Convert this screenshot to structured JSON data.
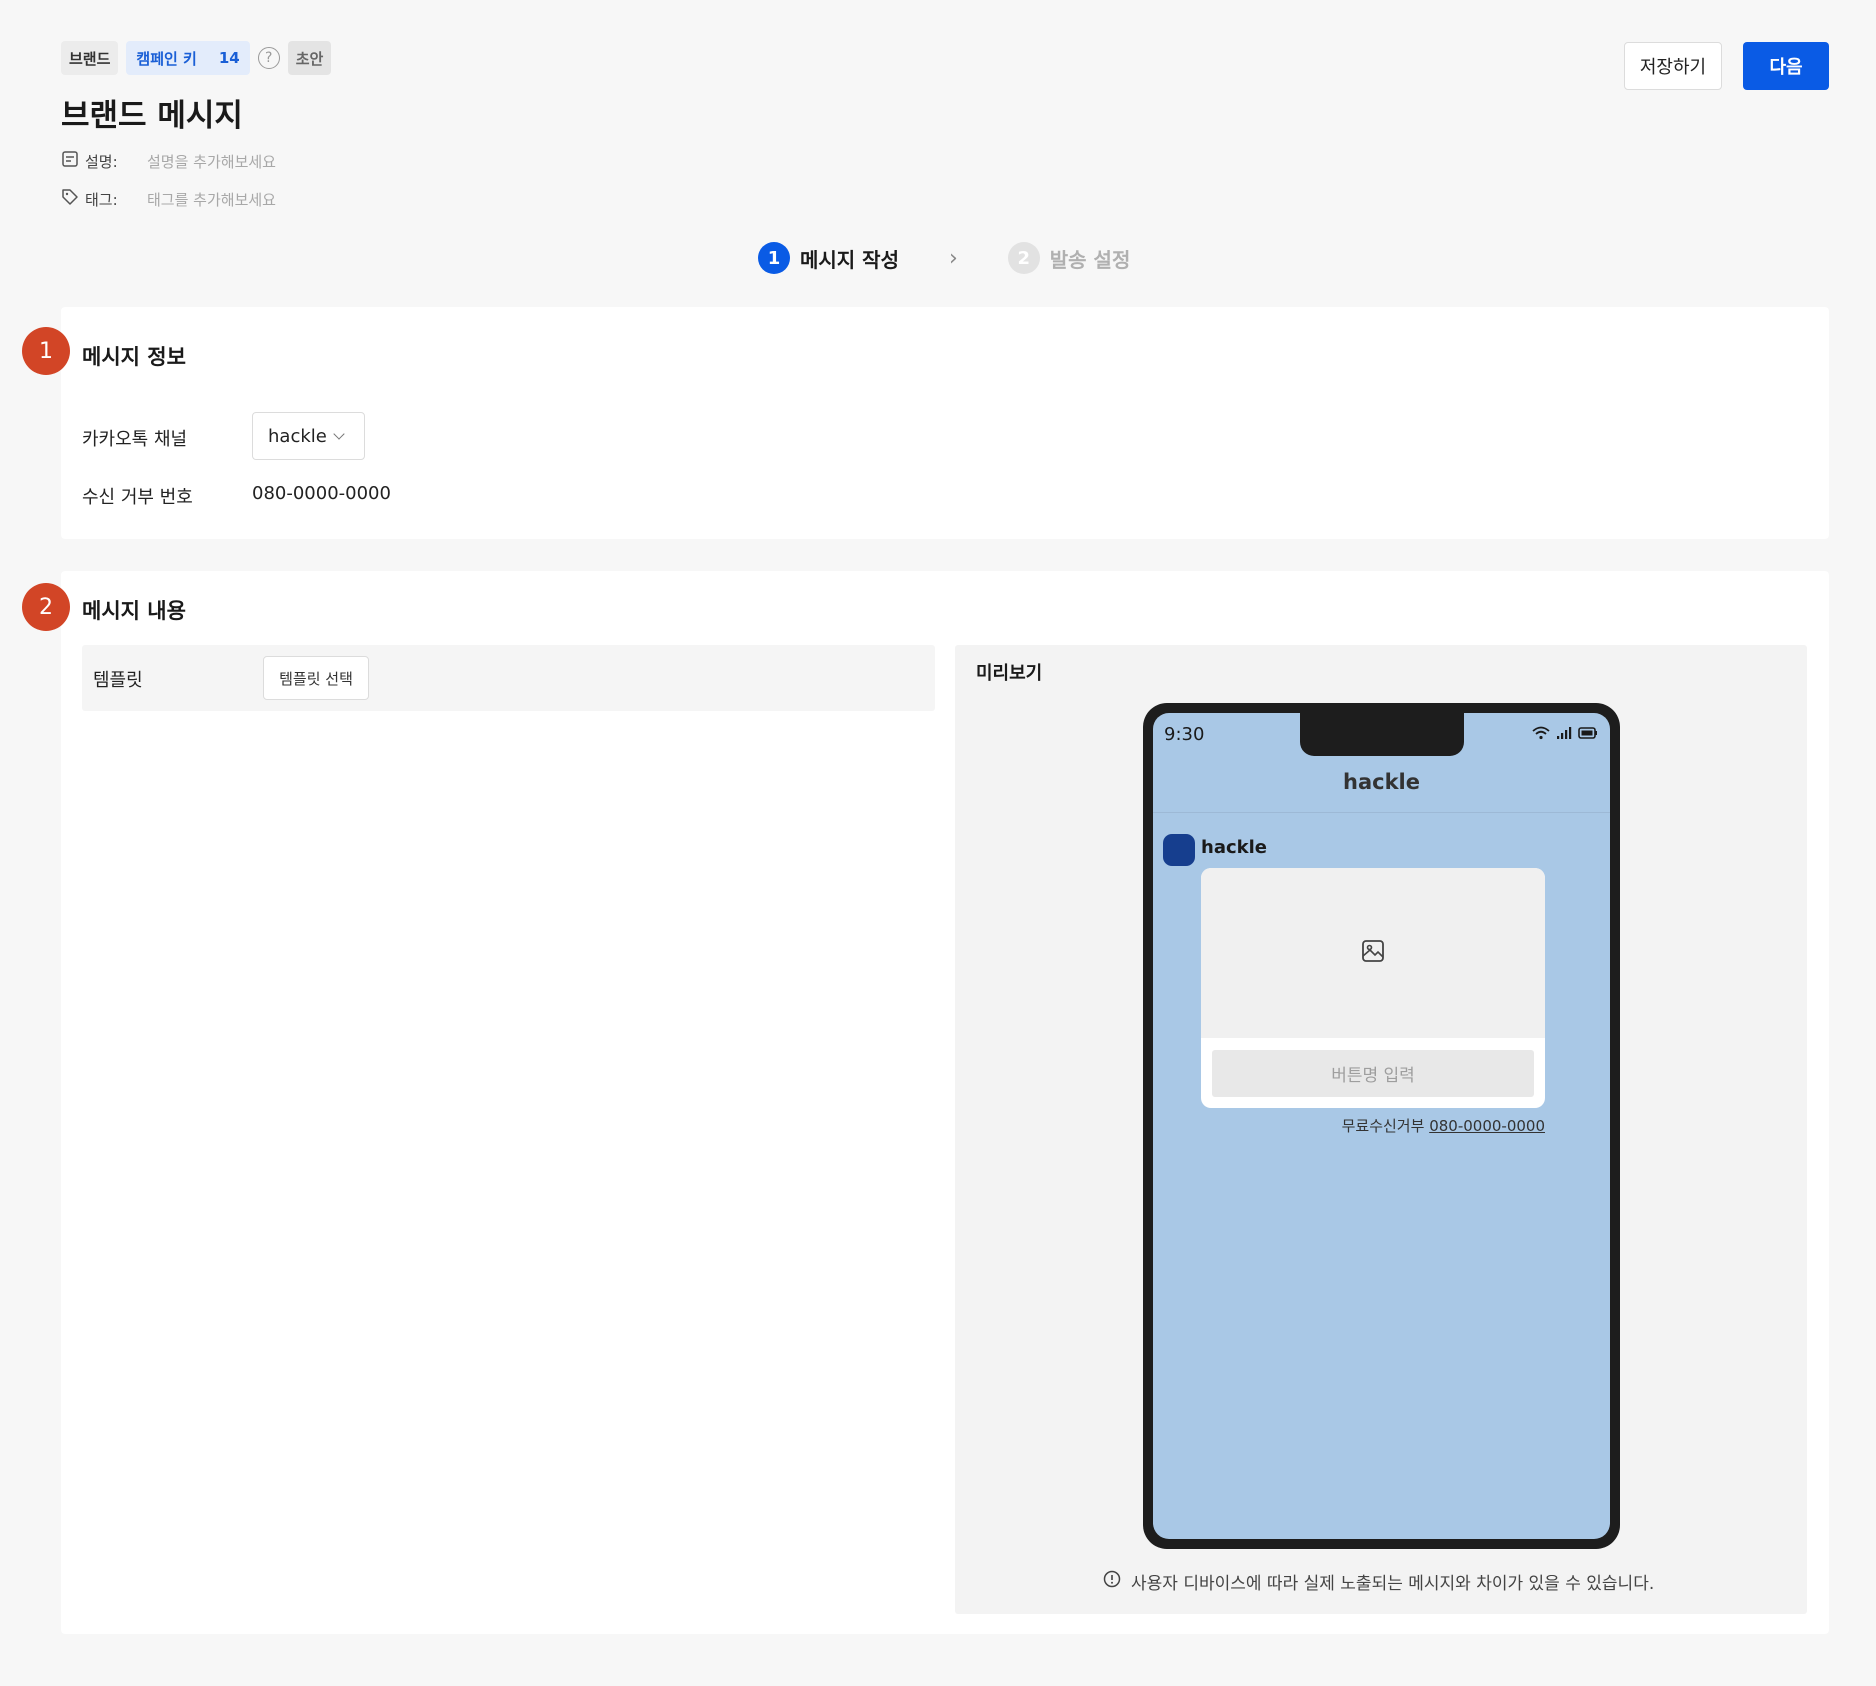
{
  "header": {
    "brand_chip": "브랜드",
    "campaign_key_label": "캠페인 키",
    "campaign_key_value": "14",
    "help_glyph": "?",
    "status_chip": "초안",
    "title": "브랜드 메시지",
    "description_label": "설명:",
    "description_placeholder": "설명을 추가해보세요",
    "tag_label": "태그:",
    "tag_placeholder": "태그를 추가해보세요"
  },
  "actions": {
    "save_label": "저장하기",
    "next_label": "다음"
  },
  "stepper": {
    "steps": [
      {
        "num": "1",
        "label": "메시지 작성",
        "state": "active"
      },
      {
        "num": "2",
        "label": "발송 설정",
        "state": "inactive"
      }
    ],
    "separator": "›"
  },
  "section1": {
    "badge": "1",
    "title": "메시지 정보",
    "channel_label": "카카오톡 채널",
    "channel_value": "hackle",
    "optout_label": "수신 거부 번호",
    "optout_value": "080-0000-0000"
  },
  "section2": {
    "badge": "2",
    "title": "메시지 내용",
    "template_label": "템플릿",
    "template_button": "템플릿 선택",
    "preview_title": "미리보기",
    "phone": {
      "time": "9:30",
      "chat_title": "hackle",
      "sender_name": "hackle",
      "button_placeholder": "버튼명 입력",
      "optout_prefix": "무료수신거부",
      "optout_number": "080-0000-0000"
    },
    "notice": "사용자 디바이스에 따라 실제 노출되는 메시지와 차이가 있을 수 있습니다."
  },
  "colors": {
    "primary": "#0a5be5",
    "badge": "#d24526",
    "phone_screen": "#a9c8e6",
    "avatar": "#163e8e"
  },
  "icons": [
    "question-icon",
    "memo-icon",
    "tag-icon",
    "chevron-right-icon",
    "chevron-down-icon",
    "wifi-icon",
    "signal-icon",
    "battery-icon",
    "image-icon",
    "info-icon"
  ]
}
